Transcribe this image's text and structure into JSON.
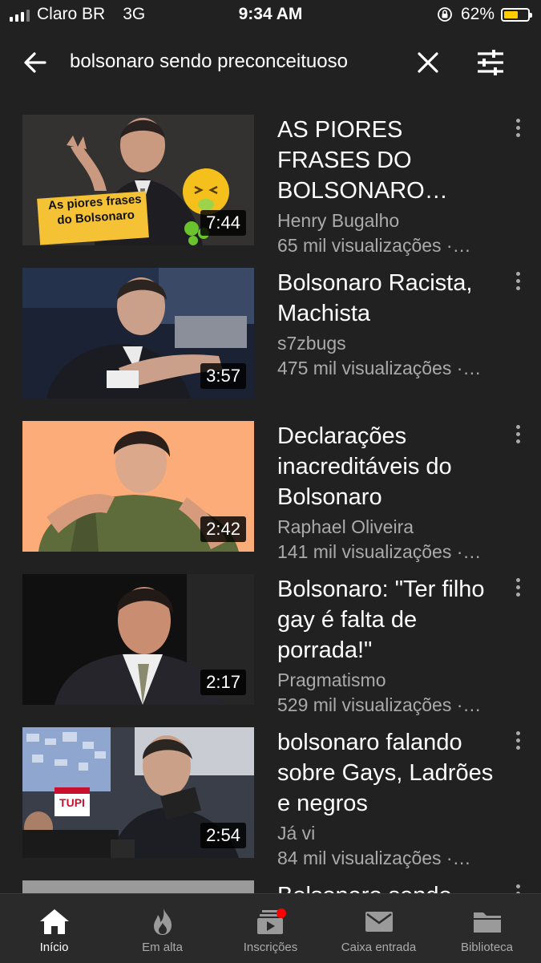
{
  "status_bar": {
    "carrier": "Claro BR",
    "network": "3G",
    "time": "9:34 AM",
    "battery": "62%",
    "battery_level": 0.62
  },
  "search": {
    "query": "bolsonaro sendo preconceituoso"
  },
  "results": [
    {
      "title": "AS PIORES FRASES DO BOLSONARO…",
      "channel": "Henry Bugalho",
      "views": "65 mil visualizações ·…",
      "duration": "7:44",
      "thumb_text": [
        "As piores frases",
        "do Bolsonaro"
      ]
    },
    {
      "title": "Bolsonaro Racista, Machista",
      "channel": "s7zbugs",
      "views": "475 mil visualizações ·…",
      "duration": "3:57"
    },
    {
      "title": "Declarações inacreditáveis do Bolsonaro",
      "channel": "Raphael Oliveira",
      "views": "141 mil visualizações ·…",
      "duration": "2:42"
    },
    {
      "title": "Bolsonaro: \"Ter filho gay é falta de porrada!\"",
      "channel": "Pragmatismo",
      "views": "529 mil visualizações ·…",
      "duration": "2:17"
    },
    {
      "title": "bolsonaro falando sobre Gays, Ladrões e negros",
      "channel": "Já vi",
      "views": "84 mil visualizações ·…",
      "duration": "2:54",
      "thumb_text": [
        "TUPI"
      ]
    },
    {
      "title": "Bolsonaro sendo",
      "channel": "",
      "views": "",
      "duration": ""
    }
  ],
  "nav": {
    "home": "Início",
    "trending": "Em alta",
    "subscriptions": "Inscrições",
    "inbox": "Caixa entrada",
    "library": "Biblioteca"
  },
  "icons": {
    "back": "arrow-left-icon",
    "clear": "close-icon",
    "filter": "sliders-icon",
    "more": "more-vert-icon"
  },
  "colors": {
    "background": "#212121",
    "battery": "#ffcc00",
    "notification": "#ff0000"
  }
}
